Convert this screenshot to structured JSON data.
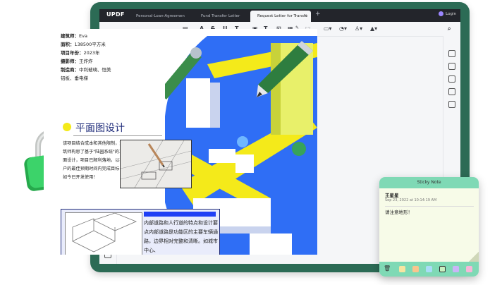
{
  "app": {
    "logo": "UPDF",
    "login": "Login"
  },
  "tabs": [
    {
      "label": "Personal-Loan-Agreemen",
      "active": false
    },
    {
      "label": "Fund Transfer Letter",
      "active": false
    },
    {
      "label": "Request Letter for Transfe",
      "active": true
    }
  ],
  "toolbar": {
    "strike": "S",
    "underline": "U",
    "squiggly": "T",
    "text_t": "T"
  },
  "document": {
    "meta": [
      {
        "label": "建筑师：",
        "value": "Eva"
      },
      {
        "label": "面积：",
        "value": "138500平方米"
      },
      {
        "label": "项目年份：",
        "value": "2023年"
      },
      {
        "label": "摄影师：",
        "value": "王炸炸"
      },
      {
        "label": "制造商：",
        "value": "中利玻璃、恒美"
      },
      {
        "label": "",
        "value": "铝板、垂电梯"
      }
    ],
    "section_title": "平面图设计",
    "paragraph1": "该项目结合成本和其他限制，建筑师构思了基于\"陆园系统\"的立面设计，项目已顺利落地，以客户的最佳预期时间内完成目标，如今已开发使用！",
    "paragraph2": "内部道路和人行道的特点和设计要点内部道路是功能区的主要车辆通路，边界相对完整和清晰。如城市中心、"
  },
  "sticky_note": {
    "header": "Sticky Note",
    "author": "王星星",
    "date": "Sep 23, 2022 at 10:14:19 AM",
    "message": "请注意地形！",
    "colors": [
      "#f7e5a1",
      "#f9c58d",
      "#a9dcf7",
      "#c7f0c0",
      "#c9b6f7",
      "#f6b7d8"
    ]
  },
  "colors": {
    "frame": "#2c6b55",
    "accent_blue": "#1f3ff5",
    "lock_green": "#2fbf5a"
  }
}
